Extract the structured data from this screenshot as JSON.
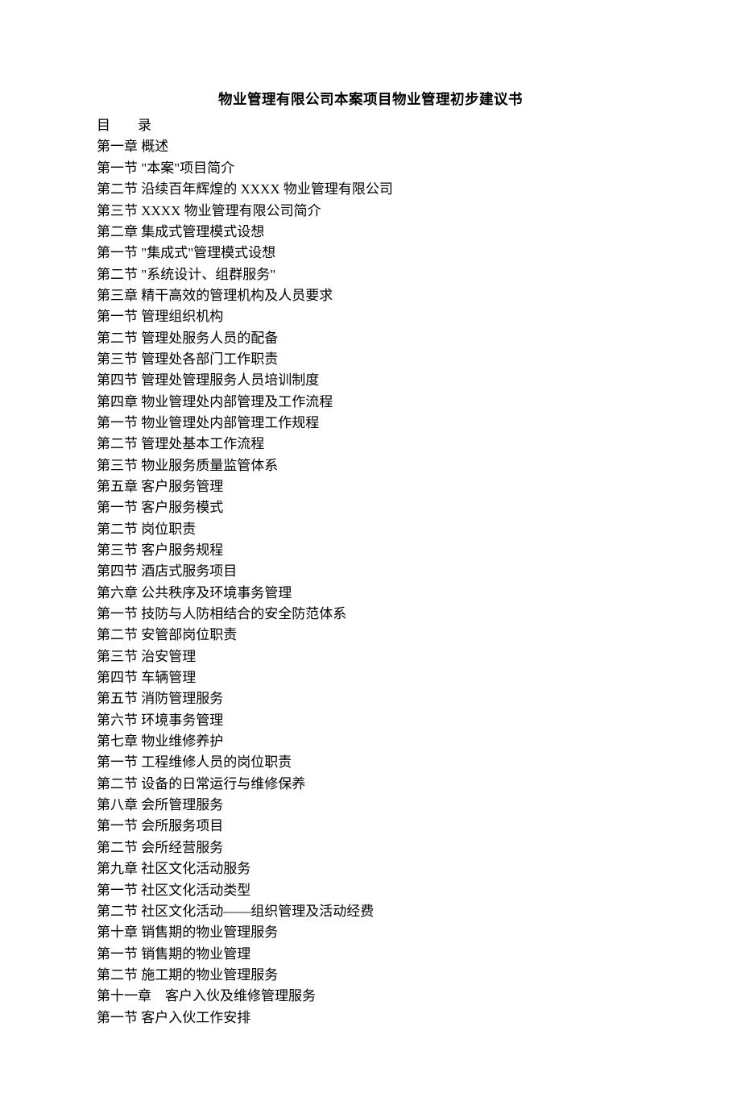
{
  "title": "物业管理有限公司本案项目物业管理初步建议书",
  "toc_label": "目　　录",
  "lines": [
    "第一章 概述",
    "第一节 \"本案\"项目简介",
    "第二节 沿续百年辉煌的 XXXX 物业管理有限公司",
    "第三节 XXXX 物业管理有限公司简介",
    "第二章 集成式管理模式设想",
    "第一节 \"集成式\"管理模式设想",
    "第二节 \"系统设计、组群服务\"",
    "第三章 精干高效的管理机构及人员要求",
    "第一节 管理组织机构",
    "第二节 管理处服务人员的配备",
    "第三节 管理处各部门工作职责",
    "第四节 管理处管理服务人员培训制度",
    "第四章 物业管理处内部管理及工作流程",
    "第一节 物业管理处内部管理工作规程",
    "第二节 管理处基本工作流程",
    "第三节 物业服务质量监管体系",
    "第五章 客户服务管理",
    "第一节 客户服务模式",
    "第二节 岗位职责",
    "第三节 客户服务规程",
    "第四节 酒店式服务项目",
    "第六章 公共秩序及环境事务管理",
    "第一节 技防与人防相结合的安全防范体系",
    "第二节 安管部岗位职责",
    "第三节 治安管理",
    "第四节 车辆管理",
    "第五节 消防管理服务",
    "第六节 环境事务管理",
    "第七章 物业维修养护",
    "第一节 工程维修人员的岗位职责",
    "第二节 设备的日常运行与维修保养",
    "第八章 会所管理服务",
    "第一节 会所服务项目",
    "第二节 会所经营服务",
    "第九章 社区文化活动服务",
    "第一节 社区文化活动类型",
    "第二节 社区文化活动——组织管理及活动经费",
    "第十章 销售期的物业管理服务",
    "第一节 销售期的物业管理",
    "第二节 施工期的物业管理服务",
    "第十一章　客户入伙及维修管理服务",
    "第一节 客户入伙工作安排"
  ]
}
